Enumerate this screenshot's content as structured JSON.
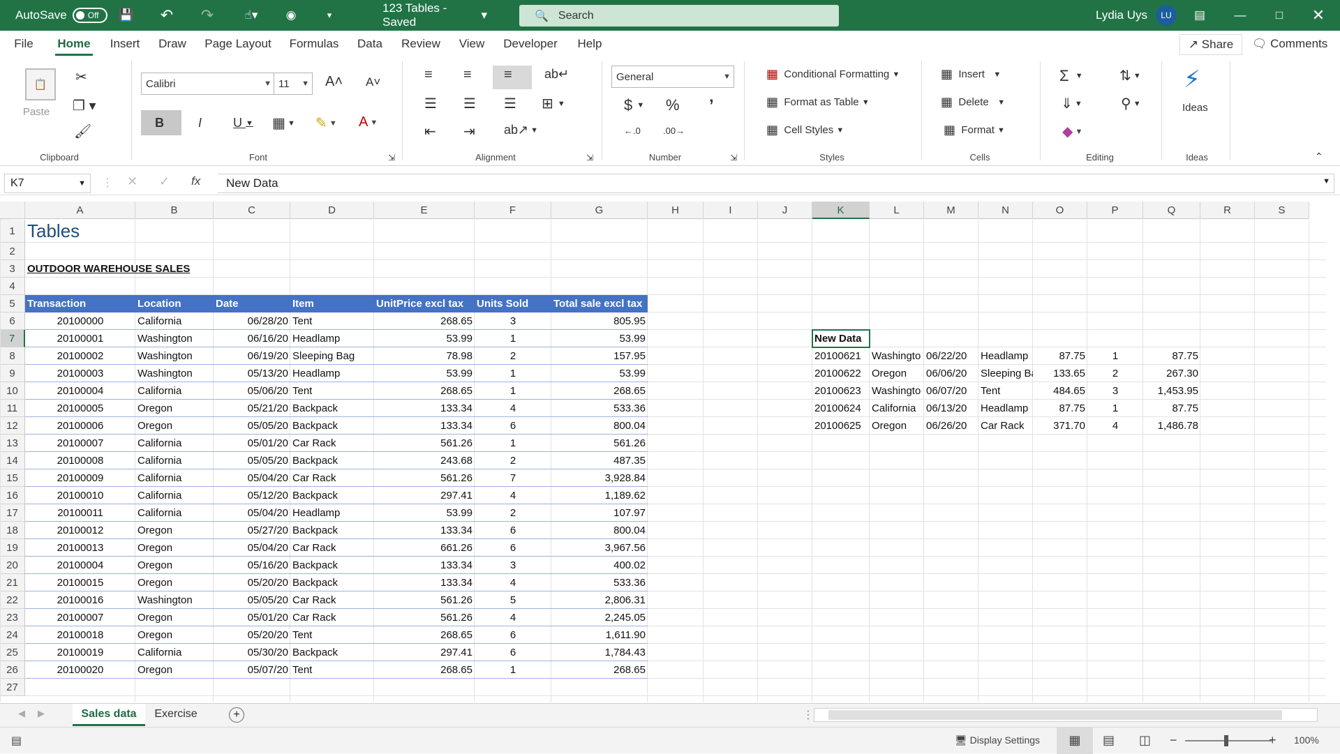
{
  "titlebar": {
    "autosave_label": "AutoSave",
    "autosave_state": "Off",
    "doc_title": "123 Tables  -  Saved",
    "search_placeholder": "Search",
    "user_name": "Lydia Uys",
    "user_initials": "LU"
  },
  "menu": {
    "tabs": [
      "File",
      "Home",
      "Insert",
      "Draw",
      "Page Layout",
      "Formulas",
      "Data",
      "Review",
      "View",
      "Developer",
      "Help"
    ],
    "share": "Share",
    "comments": "Comments"
  },
  "ribbon": {
    "clipboard": {
      "paste": "Paste",
      "label": "Clipboard"
    },
    "font": {
      "name": "Calibri",
      "size": "11",
      "bold": "B",
      "italic": "I",
      "underline": "U",
      "label": "Font"
    },
    "alignment": {
      "label": "Alignment"
    },
    "number": {
      "format": "General",
      "label": "Number"
    },
    "styles": {
      "conditional": "Conditional Formatting",
      "format_table": "Format as Table",
      "cell_styles": "Cell Styles",
      "label": "Styles"
    },
    "cells": {
      "insert": "Insert",
      "delete": "Delete",
      "format": "Format",
      "label": "Cells"
    },
    "editing": {
      "label": "Editing"
    },
    "ideas": {
      "button": "Ideas",
      "label": "Ideas"
    }
  },
  "formula": {
    "namebox": "K7",
    "fx": "fx",
    "value": "New Data"
  },
  "columns": [
    "A",
    "B",
    "C",
    "D",
    "E",
    "F",
    "G",
    "H",
    "I",
    "J",
    "K",
    "L",
    "M",
    "N",
    "O",
    "P",
    "Q",
    "R",
    "S"
  ],
  "rows": [
    "1",
    "2",
    "3",
    "4",
    "5",
    "6",
    "7",
    "8",
    "9",
    "10",
    "11",
    "12",
    "13",
    "14",
    "15",
    "16",
    "17",
    "18",
    "19",
    "20",
    "21",
    "22",
    "23",
    "24",
    "25",
    "26",
    "27"
  ],
  "sheet": {
    "title": "Tables",
    "subtitle": "OUTDOOR WAREHOUSE SALES",
    "headers": [
      "Transaction",
      "Location",
      "Date",
      "Item",
      "UnitPrice excl tax",
      "Units Sold",
      "Total sale excl tax"
    ],
    "table": [
      [
        "20100000",
        "California",
        "06/28/20",
        "Tent",
        "268.65",
        "3",
        "805.95"
      ],
      [
        "20100001",
        "Washington",
        "06/16/20",
        "Headlamp",
        "53.99",
        "1",
        "53.99"
      ],
      [
        "20100002",
        "Washington",
        "06/19/20",
        "Sleeping Bag",
        "78.98",
        "2",
        "157.95"
      ],
      [
        "20100003",
        "Washington",
        "05/13/20",
        "Headlamp",
        "53.99",
        "1",
        "53.99"
      ],
      [
        "20100004",
        "California",
        "05/06/20",
        "Tent",
        "268.65",
        "1",
        "268.65"
      ],
      [
        "20100005",
        "Oregon",
        "05/21/20",
        "Backpack",
        "133.34",
        "4",
        "533.36"
      ],
      [
        "20100006",
        "Oregon",
        "05/05/20",
        "Backpack",
        "133.34",
        "6",
        "800.04"
      ],
      [
        "20100007",
        "California",
        "05/01/20",
        "Car Rack",
        "561.26",
        "1",
        "561.26"
      ],
      [
        "20100008",
        "California",
        "05/05/20",
        "Backpack",
        "243.68",
        "2",
        "487.35"
      ],
      [
        "20100009",
        "California",
        "05/04/20",
        "Car Rack",
        "561.26",
        "7",
        "3,928.84"
      ],
      [
        "20100010",
        "California",
        "05/12/20",
        "Backpack",
        "297.41",
        "4",
        "1,189.62"
      ],
      [
        "20100011",
        "California",
        "05/04/20",
        "Headlamp",
        "53.99",
        "2",
        "107.97"
      ],
      [
        "20100012",
        "Oregon",
        "05/27/20",
        "Backpack",
        "133.34",
        "6",
        "800.04"
      ],
      [
        "20100013",
        "Oregon",
        "05/04/20",
        "Car Rack",
        "661.26",
        "6",
        "3,967.56"
      ],
      [
        "20100004",
        "Oregon",
        "05/16/20",
        "Backpack",
        "133.34",
        "3",
        "400.02"
      ],
      [
        "20100015",
        "Oregon",
        "05/20/20",
        "Backpack",
        "133.34",
        "4",
        "533.36"
      ],
      [
        "20100016",
        "Washington",
        "05/05/20",
        "Car Rack",
        "561.26",
        "5",
        "2,806.31"
      ],
      [
        "20100007",
        "Oregon",
        "05/01/20",
        "Car Rack",
        "561.26",
        "4",
        "2,245.05"
      ],
      [
        "20100018",
        "Oregon",
        "05/20/20",
        "Tent",
        "268.65",
        "6",
        "1,611.90"
      ],
      [
        "20100019",
        "California",
        "05/30/20",
        "Backpack",
        "297.41",
        "6",
        "1,784.43"
      ],
      [
        "20100020",
        "Oregon",
        "05/07/20",
        "Tent",
        "268.65",
        "1",
        "268.65"
      ]
    ],
    "new_data_label": "New Data",
    "new_data": [
      [
        "20100621",
        "Washingto",
        "06/22/20",
        "Headlamp",
        "87.75",
        "1",
        "87.75"
      ],
      [
        "20100622",
        "Oregon",
        "06/06/20",
        "Sleeping Ba",
        "133.65",
        "2",
        "267.30"
      ],
      [
        "20100623",
        "Washingto",
        "06/07/20",
        "Tent",
        "484.65",
        "3",
        "1,453.95"
      ],
      [
        "20100624",
        "California",
        "06/13/20",
        "Headlamp",
        "87.75",
        "1",
        "87.75"
      ],
      [
        "20100625",
        "Oregon",
        "06/26/20",
        "Car Rack",
        "371.70",
        "4",
        "1,486.78"
      ]
    ]
  },
  "sheet_tabs": [
    "Sales data",
    "Exercise"
  ],
  "status": {
    "display_settings": "Display Settings",
    "zoom": "100%"
  },
  "colors": {
    "accent": "#217346",
    "table_header": "#4472c4",
    "title_blue": "#1f4e79"
  }
}
